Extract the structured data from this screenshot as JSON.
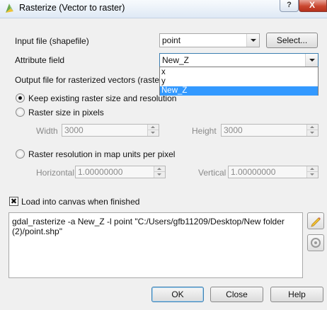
{
  "window": {
    "title": "Rasterize (Vector to raster)",
    "help_glyph": "?",
    "close_glyph": "X",
    "icon": "qgis-logo-icon"
  },
  "input_file": {
    "label": "Input file (shapefile)",
    "value": "point",
    "browse_label": "Select..."
  },
  "attribute": {
    "label": "Attribute field",
    "value": "New_Z",
    "options": [
      "x",
      "y",
      "New_Z"
    ],
    "selected_index": 2
  },
  "output": {
    "label": "Output file for rasterized vectors (raster)"
  },
  "mode": {
    "keep_label": "Keep existing raster size and resolution",
    "pixels_label": "Raster size in pixels",
    "resolution_label": "Raster resolution in map units per pixel",
    "selected": "keep"
  },
  "size": {
    "width_label": "Width",
    "width_value": "3000",
    "height_label": "Height",
    "height_value": "3000"
  },
  "resolution": {
    "horizontal_label": "Horizontal",
    "horizontal_value": "1.00000000",
    "vertical_label": "Vertical",
    "vertical_value": "1.00000000"
  },
  "load_canvas": {
    "label": "Load into canvas when finished",
    "checked": true,
    "check_glyph": "✖"
  },
  "command": {
    "text": "gdal_rasterize -a New_Z -l point \"C:/Users/gfb11209/Desktop/New folder (2)/point.shp\""
  },
  "side_tools": {
    "edit_icon": "pencil-icon",
    "reset_icon": "reset-icon"
  },
  "buttons": {
    "ok": "OK",
    "close": "Close",
    "help": "Help"
  },
  "colors": {
    "selection": "#3399ff",
    "focus_border": "#3c7fb1",
    "dialog_bg": "#f0f0f0"
  }
}
